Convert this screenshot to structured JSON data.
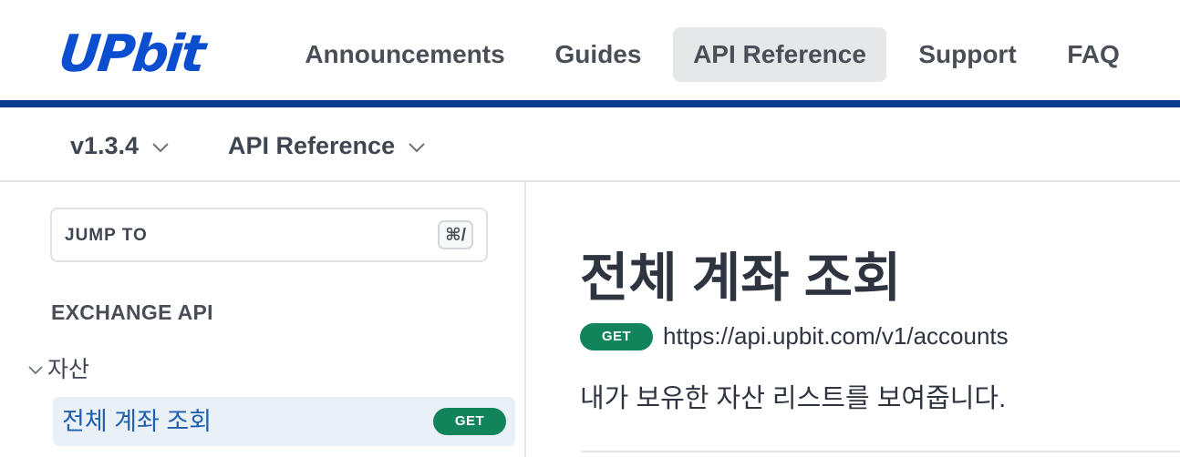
{
  "header": {
    "logo_text": "UPbit",
    "brand_color": "#0b3a8f",
    "nav": [
      {
        "label": "Announcements",
        "active": false
      },
      {
        "label": "Guides",
        "active": false
      },
      {
        "label": "API Reference",
        "active": true
      },
      {
        "label": "Support",
        "active": false
      },
      {
        "label": "FAQ",
        "active": false
      }
    ]
  },
  "subheader": {
    "version": "v1.3.4",
    "section": "API Reference"
  },
  "sidebar": {
    "jump_to": "JUMP TO",
    "shortcut": "⌘/",
    "section_title": "EXCHANGE API",
    "group": "자산",
    "items": [
      {
        "label": "전체 계좌 조회",
        "method": "GET",
        "active": true
      }
    ]
  },
  "main": {
    "title": "전체 계좌 조회",
    "method": "GET",
    "url": "https://api.upbit.com/v1/accounts",
    "description": "내가 보유한 자산 리스트를 보여줍니다.",
    "method_color": "#12845b"
  }
}
